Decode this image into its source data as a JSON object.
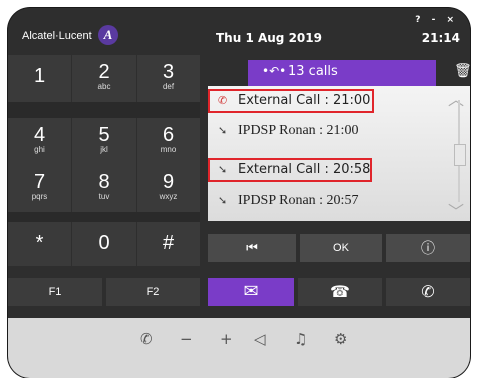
{
  "header": {
    "brand": "Alcatel·Lucent",
    "logo_glyph": "A",
    "date": "Thu 1 Aug 2019",
    "time": "21:14",
    "window_controls": [
      "?",
      "-",
      "×"
    ]
  },
  "keypad": [
    {
      "digit": "1",
      "letters": ""
    },
    {
      "digit": "2",
      "letters": "abc"
    },
    {
      "digit": "3",
      "letters": "def"
    },
    {
      "digit": "4",
      "letters": "ghi"
    },
    {
      "digit": "5",
      "letters": "jkl"
    },
    {
      "digit": "6",
      "letters": "mno"
    },
    {
      "digit": "7",
      "letters": "pqrs"
    },
    {
      "digit": "8",
      "letters": "tuv"
    },
    {
      "digit": "9",
      "letters": "wxyz"
    },
    {
      "digit": "*",
      "letters": ""
    },
    {
      "digit": "0",
      "letters": ""
    },
    {
      "digit": "#",
      "letters": ""
    }
  ],
  "function_keys": [
    "F1",
    "F2"
  ],
  "calls_tab": {
    "label": "13 calls",
    "icon": "missed-call-icon"
  },
  "call_log": [
    {
      "text": "External Call :  21:00",
      "icon": "missed-call-icon",
      "highlighted": true
    },
    {
      "text": "IPDSP Ronan :  21:00",
      "icon": "outgoing-call-icon",
      "highlighted": false
    },
    {
      "text": "External Call :  20:58",
      "icon": "incoming-call-icon",
      "highlighted": true
    },
    {
      "text": "IPDSP Ronan :  20:57",
      "icon": "outgoing-call-icon",
      "highlighted": false
    }
  ],
  "softkeys": {
    "ok_label": "OK"
  },
  "colors": {
    "accent_purple": "#7a3cc8",
    "highlight_red": "#e0252b",
    "body_dark": "#2e2e2e"
  }
}
